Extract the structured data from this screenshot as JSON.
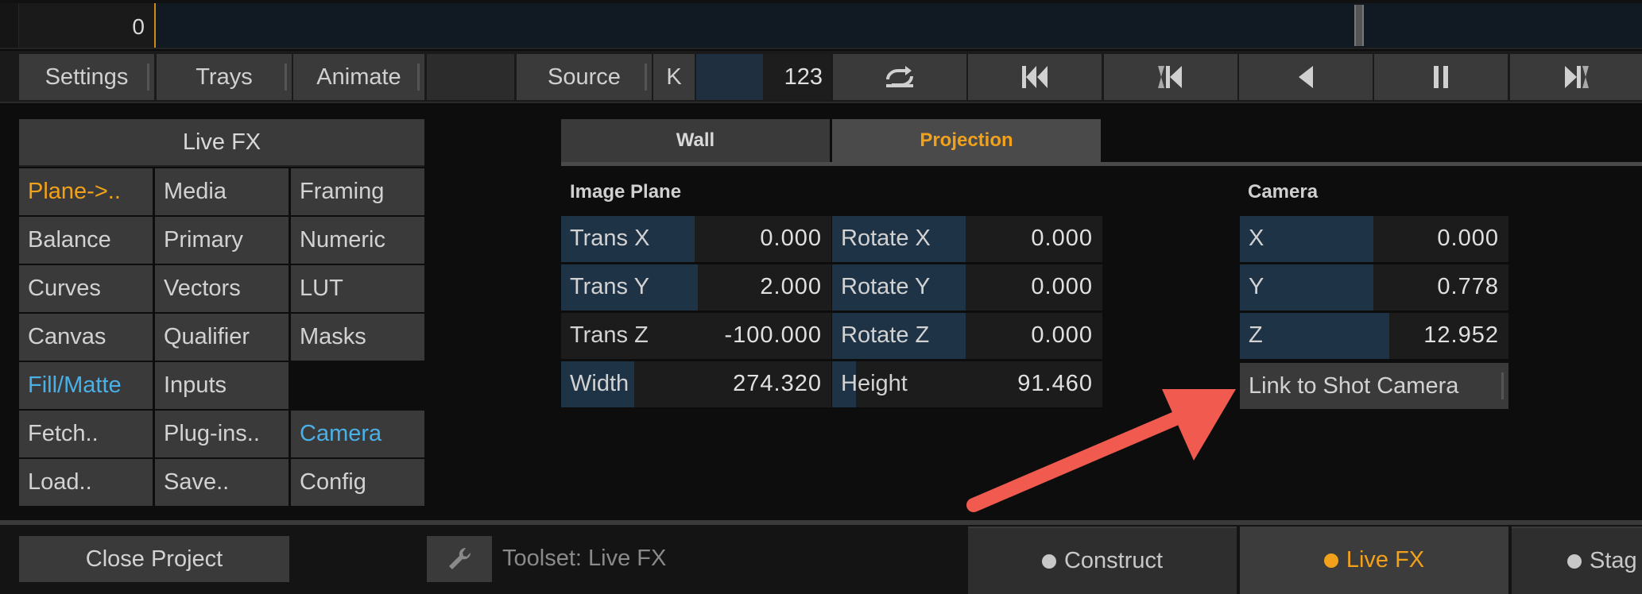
{
  "timeline": {
    "frame": "0"
  },
  "toolbar": {
    "settings": "Settings",
    "trays": "Trays",
    "animate": "Animate",
    "source": "Source",
    "k": "K",
    "value": "123"
  },
  "toolset": {
    "title": "Live FX",
    "cells": [
      [
        "Plane->..",
        "Media",
        "Framing"
      ],
      [
        "Balance",
        "Primary",
        "Numeric"
      ],
      [
        "Curves",
        "Vectors",
        "LUT"
      ],
      [
        "Canvas",
        "Qualifier",
        "Masks"
      ],
      [
        "Fill/Matte",
        "Inputs",
        ""
      ],
      [
        "Fetch..",
        "Plug-ins..",
        "Camera"
      ],
      [
        "Load..",
        "Save..",
        "Config"
      ]
    ]
  },
  "tabs": {
    "wall": "Wall",
    "projection": "Projection"
  },
  "image_plane": {
    "title": "Image Plane",
    "trans_x": {
      "label": "Trans X",
      "value": "0.000"
    },
    "trans_y": {
      "label": "Trans Y",
      "value": "2.000"
    },
    "trans_z": {
      "label": "Trans Z",
      "value": "-100.000"
    },
    "width": {
      "label": "Width",
      "value": "274.320"
    },
    "rotate_x": {
      "label": "Rotate X",
      "value": "0.000"
    },
    "rotate_y": {
      "label": "Rotate Y",
      "value": "0.000"
    },
    "rotate_z": {
      "label": "Rotate Z",
      "value": "0.000"
    },
    "height": {
      "label": "Height",
      "value": "91.460"
    }
  },
  "camera": {
    "title": "Camera",
    "x": {
      "label": "X",
      "value": "0.000"
    },
    "y": {
      "label": "Y",
      "value": "0.778"
    },
    "z": {
      "label": "Z",
      "value": "12.952"
    },
    "link": "Link to Shot Camera"
  },
  "bottom": {
    "close_project": "Close Project",
    "toolset_label": "Toolset: Live FX",
    "mode_construct": "Construct",
    "mode_livefx": "Live FX",
    "mode_stage": "Stag"
  },
  "colors": {
    "accent_orange": "#f2a11a",
    "accent_blue": "#4ab0e8",
    "arrow_red": "#f05a4f"
  }
}
